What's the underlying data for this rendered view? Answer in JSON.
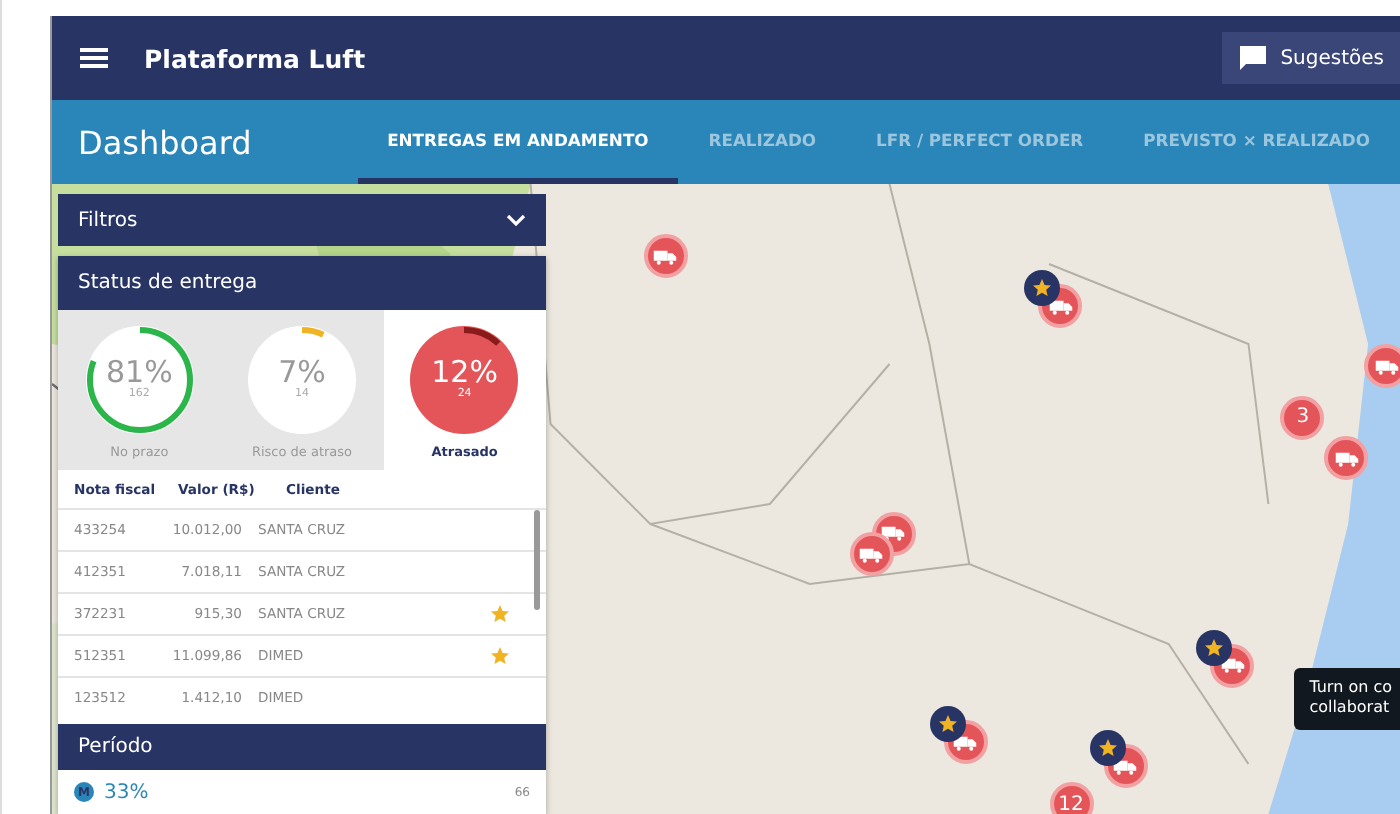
{
  "app_bar": {
    "title": "Plataforma Luft",
    "feedback_button": "Sugestões"
  },
  "header": {
    "title": "Dashboard"
  },
  "tabs": [
    {
      "label": "ENTREGAS EM ANDAMENTO",
      "selected": true
    },
    {
      "label": "REALIZADO",
      "selected": false
    },
    {
      "label": "LFR / PERFECT ORDER",
      "selected": false
    },
    {
      "label": "PREVISTO × REALIZADO",
      "selected": false
    }
  ],
  "filters": {
    "title": "Filtros"
  },
  "delivery_status": {
    "title": "Status de entrega",
    "gauges": [
      {
        "percent": "81%",
        "count": "162",
        "label": "No prazo",
        "level": 0.81,
        "color": "#2bb54a",
        "selected": false
      },
      {
        "percent": "7%",
        "count": "14",
        "label": "Risco de atraso",
        "level": 0.07,
        "color": "#f0b323",
        "selected": false
      },
      {
        "percent": "12%",
        "count": "24",
        "label": "Atrasado",
        "level": 0.12,
        "color": "#8b1a1a",
        "selected": true
      }
    ],
    "columns": [
      "Nota fiscal",
      "Valor (R$)",
      "Cliente"
    ],
    "rows": [
      {
        "invoice": "433254",
        "value": "10.012,00",
        "client": "SANTA CRUZ",
        "starred": false
      },
      {
        "invoice": "412351",
        "value": "7.018,11",
        "client": "SANTA CRUZ",
        "starred": false
      },
      {
        "invoice": "372231",
        "value": "915,30",
        "client": "SANTA CRUZ",
        "starred": true
      },
      {
        "invoice": "512351",
        "value": "11.099,86",
        "client": "DIMED",
        "starred": true
      },
      {
        "invoice": "123512",
        "value": "1.412,10",
        "client": "DIMED",
        "starred": false
      }
    ]
  },
  "period": {
    "title": "Período",
    "badge": "M",
    "percent": "33%",
    "count": "66"
  },
  "map": {
    "markers": [
      {
        "kind": "truck",
        "starred": false
      },
      {
        "kind": "truck",
        "starred": true
      },
      {
        "kind": "truck",
        "starred": false
      },
      {
        "kind": "cluster",
        "count": "3"
      },
      {
        "kind": "truck",
        "starred": false
      },
      {
        "kind": "truck",
        "starred": false
      },
      {
        "kind": "truck",
        "starred": false
      },
      {
        "kind": "truck",
        "starred": true
      },
      {
        "kind": "truck",
        "starred": true
      },
      {
        "kind": "truck",
        "starred": true
      },
      {
        "kind": "cluster",
        "count": "12"
      }
    ],
    "tooltip": [
      "Turn on co",
      "collaborat"
    ]
  }
}
